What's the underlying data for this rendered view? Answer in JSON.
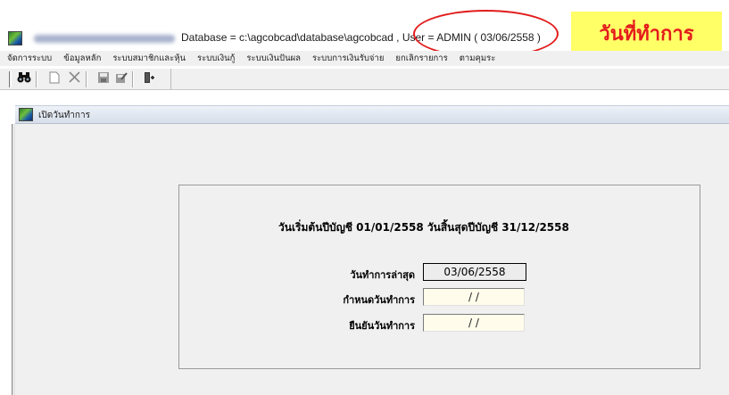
{
  "title_bar": {
    "title": "Database = c:\\agcobcad\\database\\agcobcad , User = ADMIN ( 03/06/2558 )"
  },
  "annotation": {
    "callout_text": "วันที่ทำการ",
    "highlight_color": "#ffff66",
    "text_color": "#e41b1b",
    "ellipse_color": "#e21c1c"
  },
  "menu": {
    "items": [
      "จัดการระบบ",
      "ข้อมูลหลัก",
      "ระบบสมาชิกและหุ้น",
      "ระบบเงินกู้",
      "ระบบเงินปันผล",
      "ระบบการเงินรับจ่าย",
      "ยกเลิกรายการ",
      "ตามคุมระ"
    ]
  },
  "toolbar": {
    "icons": [
      "binoculars-icon",
      "new-document-icon",
      "delete-icon",
      "save-icon",
      "edit-icon",
      "exit-door-icon"
    ]
  },
  "child_window": {
    "title": "เปิดวันทำการ"
  },
  "form": {
    "period_text": "วันเริ่มต้นปีบัญชี 01/01/2558  วันสิ้นสุดปีบัญชี 31/12/2558",
    "last_work_date_label": "วันทำการล่าสุด",
    "last_work_date_value": "03/06/2558",
    "set_work_date_label": "กำหนดวันทำการ",
    "set_work_date_value": " / /",
    "confirm_work_date_label": "ยืนยันวันทำการ",
    "confirm_work_date_value": " / /"
  }
}
